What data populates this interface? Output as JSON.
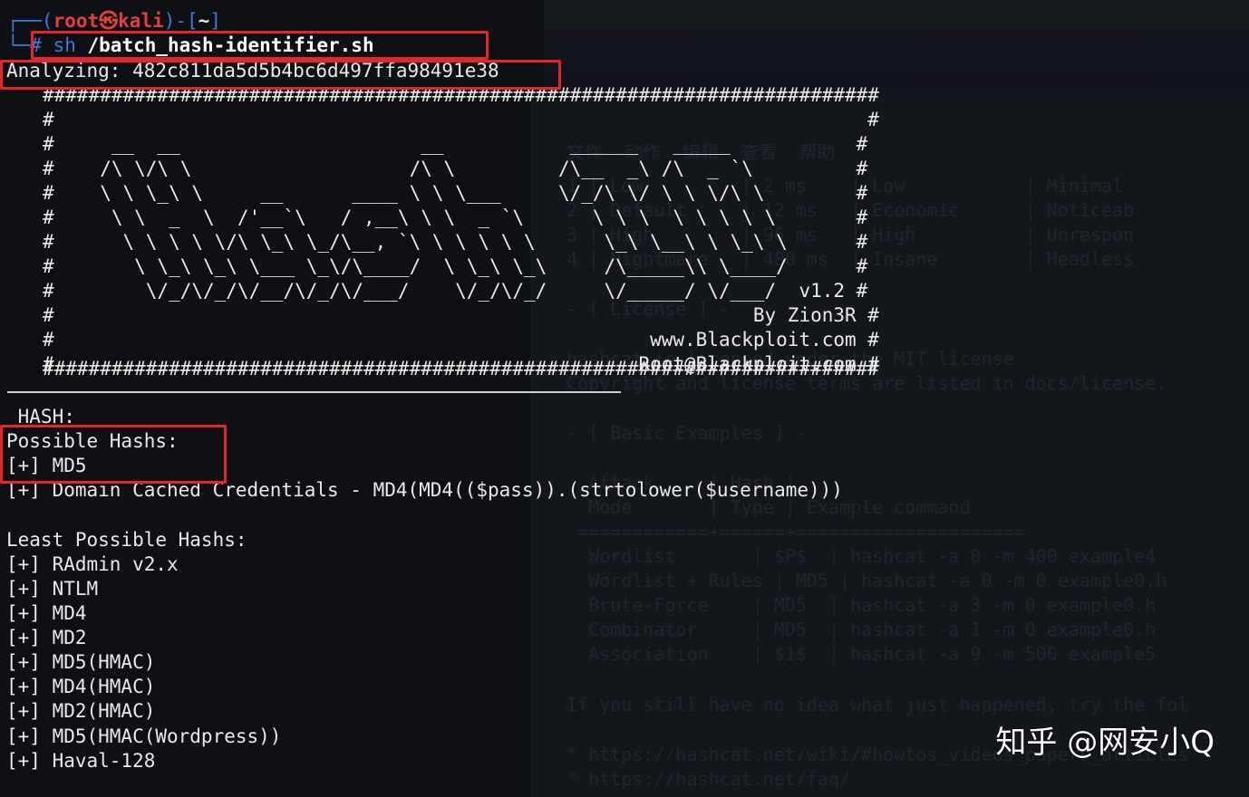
{
  "prompt": {
    "user": "root",
    "at_symbol": "㉿",
    "host": "kali",
    "cwd": "~",
    "prefix_open": "┌──(",
    "prefix_close": ")-[",
    "cwd_close": "]",
    "cmd_prefix": "└─# ",
    "command": "sh",
    "argument": " /batch_hash-identifier.sh"
  },
  "analyzing": "Analyzing: 482c811da5d5b4bc6d497ffa98491e38",
  "banner": {
    "border": "#########################################################################",
    "rows": [
      "#                                                                       #",
      "#     __  __                     __           ______   _____           #",
      "#    /\\ \\/\\ \\                   /\\ \\         /\\__  _\\ /\\  _ `\\         #",
      "#    \\ \\ \\_\\ \\     __      ____ \\ \\ \\___     \\/_/\\ \\/ \\ \\ \\/\\ \\        #",
      "#     \\ \\  _  \\  /'__`\\   / ,__\\ \\ \\  _ `\\      \\ \\ \\  \\ \\ \\ \\ \\       #",
      "#      \\ \\ \\ \\ \\/\\ \\_\\ \\_/\\__, `\\ \\ \\ \\ \\ \\      \\_\\ \\__\\ \\ \\_\\ \\      #",
      "#       \\ \\_\\ \\_\\ \\___ \\_\\/\\____/  \\ \\_\\ \\_\\     /\\_____\\\\ \\____/      #",
      "#        \\/_/\\/_/\\/__/\\/_/\\/___/    \\/_/\\/_/     \\/_____/ \\/___/  v1.2 #",
      "#                                                             By Zion3R #",
      "#                                                    www.Blackploit.com #",
      "#                                                   Root@Blackploit.com #"
    ]
  },
  "hash_label": " HASH:",
  "possible_header": "Possible Hashs:",
  "possible": [
    "[+] MD5",
    "[+] Domain Cached Credentials - MD4(MD4(($pass)).(strtolower($username)))"
  ],
  "least_header": "Least Possible Hashs:",
  "least": [
    "[+] RAdmin v2.x",
    "[+] NTLM",
    "[+] MD4",
    "[+] MD2",
    "[+] MD5(HMAC)",
    "[+] MD4(HMAC)",
    "[+] MD2(HMAC)",
    "[+] MD5(HMAC(Wordpress))",
    "[+] Haval-128"
  ],
  "background_window": [
    "文件  动作  编辑  查看  帮助",
    "1 | Low         | 2 ms    | Low           | Minimal",
    "2 | Default     | 12 ms   | Economic      | Noticeab",
    "3 | High        | 96 ms   | High          | Unrespon",
    "4 | Nightmare   | 480 ms  | Insane        | Headless",
    "- [ License ] -",
    "hashcat is licensed under the MIT license",
    "Copyright and license terms are listed in docs/license.",
    "- [ Basic Examples ] -",
    "  Attack     | Hash |",
    "  Mode       | Type | Example command",
    " ============+======+=====================",
    "  Wordlist       | $P$  | hashcat -a 0 -m 400 example4",
    "  Wordlist + Rules | MD5 | hashcat -a 0 -m 0 example0.h",
    "  Brute-Force    | MD5  | hashcat -a 3 -m 0 example0.h",
    "  Combinator     | MD5  | hashcat -a 1 -m 0 example0.h",
    "  Association    | $1$  | hashcat -a 9 -m 500 example5",
    "If you still have no idea what just happened, try the fol",
    "* https://hashcat.net/wiki/#howtos_videos_papers_articles",
    "* https://hashcat.net/faq/"
  ],
  "watermark": "知乎 @网安小Q",
  "colors": {
    "highlight_box": "#e3262a",
    "prompt_user": "#e2403b",
    "prompt_frame": "#3b7be0",
    "text": "#e9e9e9",
    "background": "#0e1014"
  }
}
